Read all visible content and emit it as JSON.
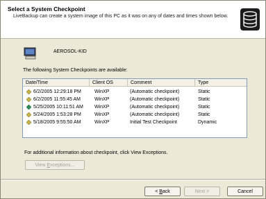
{
  "header": {
    "title": "Select a System Checkpoint",
    "subtitle": "LiveBackup can create a system image of this PC as it was on any of dates and times shown below."
  },
  "computer": {
    "name": "AEROSOL-KID"
  },
  "list": {
    "caption": "The following System Checkpoints are available:",
    "columns": [
      "Date/Time",
      "Client OS",
      "Comment",
      "Type"
    ],
    "rows": [
      {
        "datetime": "6/2/2005 12:29:18 PM",
        "os": "WinXP",
        "comment": "(Automatic checkpoint)",
        "type": "Static",
        "icon": "yellow-diamond",
        "color": "#c8b54a"
      },
      {
        "datetime": "6/2/2005 11:55:45 AM",
        "os": "WinXP",
        "comment": "(Automatic checkpoint)",
        "type": "Static",
        "icon": "yellow-diamond",
        "color": "#c8b54a"
      },
      {
        "datetime": "5/25/2005 10:11:51 AM",
        "os": "WinXP",
        "comment": "(Automatic checkpoint)",
        "type": "Static",
        "icon": "green-diamond",
        "color": "#2f8f5a"
      },
      {
        "datetime": "5/24/2005 1:53:28 PM",
        "os": "WinXP",
        "comment": "(Automatic checkpoint)",
        "type": "Static",
        "icon": "yellow-diamond",
        "color": "#c8b54a"
      },
      {
        "datetime": "5/18/2005 9:55:50 AM",
        "os": "WinXP",
        "comment": "Initial Test Checkpoint",
        "type": "Dynamic",
        "icon": "yellow-diamond",
        "color": "#c8b54a"
      }
    ]
  },
  "note": "For additional information about checkpoint, click View Exceptions.",
  "buttons": {
    "view_exceptions_prefix": "View ",
    "view_exceptions_accel": "E",
    "view_exceptions_rest": "xceptions...",
    "back_prefix": "< ",
    "back_accel": "B",
    "back_rest": "ack",
    "next": "Next >",
    "cancel": "Cancel"
  }
}
